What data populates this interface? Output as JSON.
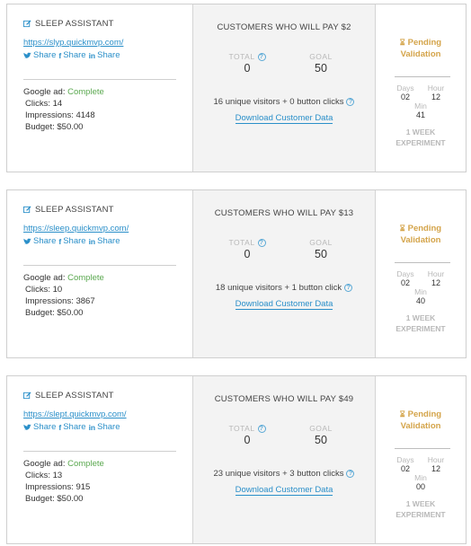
{
  "cards": [
    {
      "title": "SLEEP ASSISTANT",
      "url": "https://slyp.quickmvp.com/",
      "shares": {
        "twitter": "Share",
        "facebook": "Share",
        "linkedin": "Share"
      },
      "google_ad_label": "Google ad:",
      "google_ad_status": "Complete",
      "clicks": "Clicks: 14",
      "impressions": "Impressions: 4148",
      "budget": "Budget: $50.00",
      "heading": "CUSTOMERS WHO WILL PAY $2",
      "total_label": "TOTAL",
      "total_value": "0",
      "goal_label": "GOAL",
      "goal_value": "50",
      "visitors": "16 unique visitors + 0 button clicks",
      "download": "Download Customer Data",
      "status_line1": "Pending",
      "status_line2": "Validation",
      "days_label": "Days",
      "hour_label": "Hour",
      "days_value": "02",
      "hour_value": "12",
      "min_label": "Min",
      "min_value": "41",
      "experiment_line1": "1 WEEK",
      "experiment_line2": "EXPERIMENT"
    },
    {
      "title": "SLEEP ASSISTANT",
      "url": "https://sleep.quickmvp.com/",
      "shares": {
        "twitter": "Share",
        "facebook": "Share",
        "linkedin": "Share"
      },
      "google_ad_label": "Google ad:",
      "google_ad_status": "Complete",
      "clicks": "Clicks: 10",
      "impressions": "Impressions: 3867",
      "budget": "Budget: $50.00",
      "heading": "CUSTOMERS WHO WILL PAY $13",
      "total_label": "TOTAL",
      "total_value": "0",
      "goal_label": "GOAL",
      "goal_value": "50",
      "visitors": "18 unique visitors + 1 button click",
      "download": "Download Customer Data",
      "status_line1": "Pending",
      "status_line2": "Validation",
      "days_label": "Days",
      "hour_label": "Hour",
      "days_value": "02",
      "hour_value": "12",
      "min_label": "Min",
      "min_value": "40",
      "experiment_line1": "1 WEEK",
      "experiment_line2": "EXPERIMENT"
    },
    {
      "title": "SLEEP ASSISTANT",
      "url": "https://slept.quickmvp.com/",
      "shares": {
        "twitter": "Share",
        "facebook": "Share",
        "linkedin": "Share"
      },
      "google_ad_label": "Google ad:",
      "google_ad_status": "Complete",
      "clicks": "Clicks: 13",
      "impressions": "Impressions: 915",
      "budget": "Budget: $50.00",
      "heading": "CUSTOMERS WHO WILL PAY $49",
      "total_label": "TOTAL",
      "total_value": "0",
      "goal_label": "GOAL",
      "goal_value": "50",
      "visitors": "23 unique visitors + 3 button clicks",
      "download": "Download Customer Data",
      "status_line1": "Pending",
      "status_line2": "Validation",
      "days_label": "Days",
      "hour_label": "Hour",
      "days_value": "02",
      "hour_value": "12",
      "min_label": "Min",
      "min_value": "00",
      "experiment_line1": "1 WEEK",
      "experiment_line2": "EXPERIMENT"
    }
  ],
  "colors": {
    "link": "#2a8fc9",
    "complete": "#5aa84f",
    "pending": "#d4a44a",
    "muted": "#b8b8b8"
  },
  "icons": {
    "edit": "edit-icon",
    "twitter": "twitter-icon",
    "facebook": "facebook-icon",
    "linkedin": "linkedin-icon",
    "help": "question-circle-icon",
    "pending": "hourglass-icon"
  }
}
